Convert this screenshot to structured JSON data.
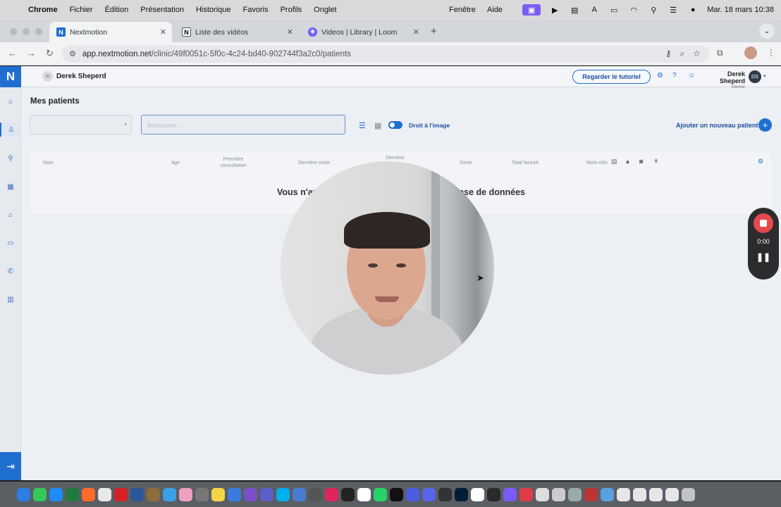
{
  "menubar": {
    "apple": "",
    "items": [
      "Chrome",
      "Fichier",
      "Édition",
      "Présentation",
      "Historique",
      "Favoris",
      "Profils",
      "Onglet"
    ],
    "right_items": [
      "Fenêtre",
      "Aide"
    ],
    "datetime": "Mar. 18 mars  10:38"
  },
  "browser": {
    "tabs": [
      {
        "label": "Nextmotion",
        "icon": "nextmotion-icon"
      },
      {
        "label": "Liste des vidéos",
        "icon": "notion-icon"
      },
      {
        "label": "Videos | Library | Loom",
        "icon": "loom-icon"
      }
    ],
    "url_host": "app.nextmotion.net",
    "url_path": "/clinic/49f0051c-5f0c-4c24-bd40-902744f3a2c0/patients"
  },
  "app": {
    "logo": "N",
    "clinic_avatar": "ds",
    "clinic_name": "Derek Sheperd",
    "tutorial_button": "Regarder le tutoriel",
    "user_name": "Derek Sheperd",
    "user_role": "Owner",
    "user_initials": "DS",
    "page_title": "Mes patients",
    "select_placeholder": "",
    "search_placeholder": "Rechercher...",
    "toggle_label": "Droit à l'image",
    "add_patient": "Ajouter un nouveau patient",
    "table_headers": {
      "nom": "Nom",
      "age": "âge",
      "premiere": "Première consultation",
      "derniere_visite": "Dernière visite",
      "derniere": "Dernière",
      "devis": "Devis",
      "total": "Total facturé",
      "mots": "Mots-clés"
    },
    "empty_message_start": "Vous n'ave",
    "empty_message_end": "base de données"
  },
  "loom": {
    "timer": "0:00"
  }
}
